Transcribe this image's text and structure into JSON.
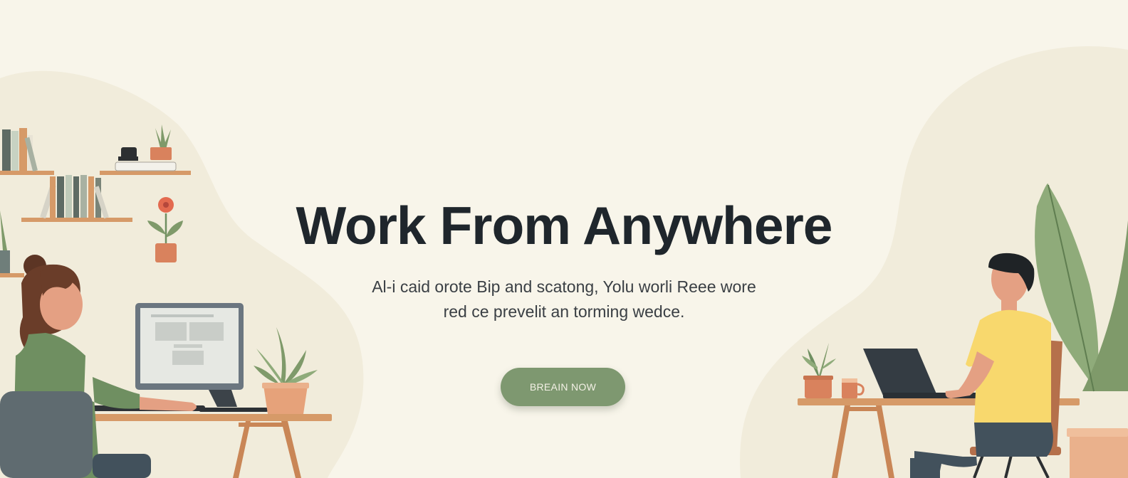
{
  "hero": {
    "title": "Work From Anywhere",
    "subtitle_line1": "Al-i caid orote Bip and scatong, Yolu worli Reee wore",
    "subtitle_line2": "red ce prevelit an torming wedce.",
    "cta_label": "BREAIN NOW"
  },
  "colors": {
    "background": "#f8f5ea",
    "blob": "#f1ecdb",
    "title": "#1f262c",
    "button": "#7e9870",
    "button_text": "#f4f1e6",
    "wood": "#d69a68",
    "plant_green": "#7f9a6a",
    "shirt_green": "#6f8f61",
    "shirt_yellow": "#f8d86d",
    "terracotta": "#d9825d"
  },
  "icons": [
    "bookshelf-icon",
    "plant-icon",
    "monitor-icon",
    "laptop-icon",
    "mug-icon",
    "chair-icon",
    "desk-icon"
  ]
}
